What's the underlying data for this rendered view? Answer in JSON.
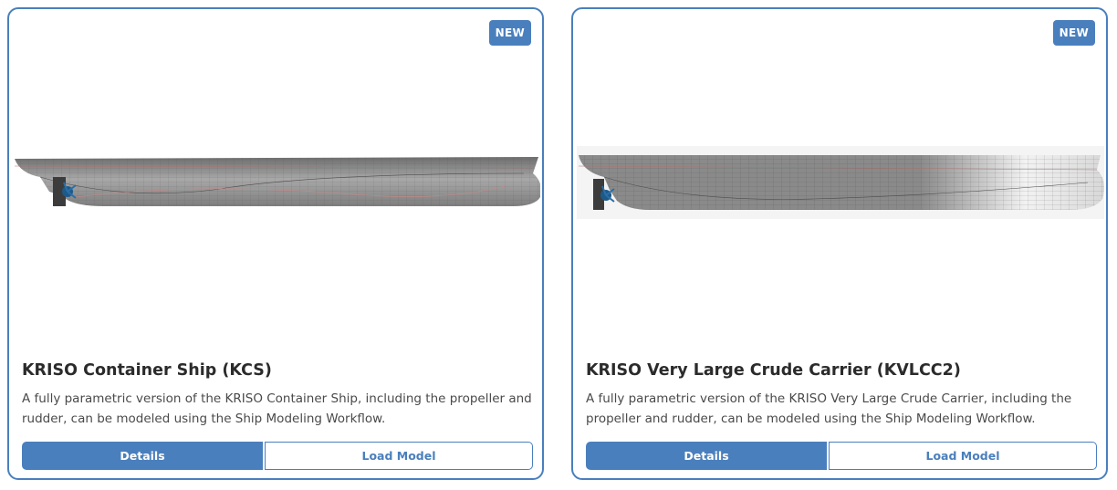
{
  "cards": [
    {
      "badge": "NEW",
      "title": "KRISO Container Ship (KCS)",
      "description": "A fully parametric version of the KRISO Container Ship, including the propeller and rudder, can be modeled using the Ship Modeling Workflow.",
      "details_label": "Details",
      "load_label": "Load Model"
    },
    {
      "badge": "NEW",
      "title": "KRISO Very Large Crude Carrier (KVLCC2)",
      "description": "A fully parametric version of the KRISO Very Large Crude Carrier, including the propeller and rudder, can be modeled using the Ship Modeling Workflow.",
      "details_label": "Details",
      "load_label": "Load Model"
    }
  ],
  "colors": {
    "accent": "#4a7fbd",
    "title": "#2b2b2b",
    "text": "#4a4a4a",
    "hull": "#9a9a9a"
  }
}
